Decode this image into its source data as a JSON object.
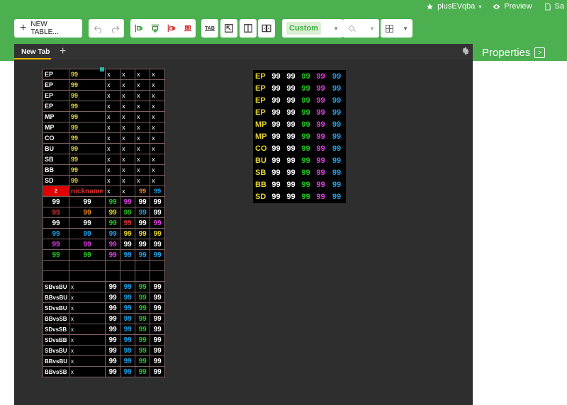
{
  "header": {
    "user": "plusEVqba",
    "preview": "Preview",
    "save_partial": "Sa"
  },
  "toolbar": {
    "new_table": "NEW TABLE...",
    "style_value": "Custom",
    "tab_icon_label": "TAB"
  },
  "editor": {
    "tab_label": "New Tab",
    "add_tab": "+"
  },
  "properties": {
    "title": "Properties",
    "toggle": ">"
  },
  "colors": {
    "green_header": "#4caf50",
    "yellow": "#e8d630",
    "white": "#ffffff",
    "green": "#21c721",
    "magenta": "#e040e0",
    "blue": "#1ea0e6",
    "orange": "#ef8a1e",
    "red": "#e03030"
  },
  "main_table": {
    "pos_rows": [
      {
        "pos": "EP",
        "val": "99",
        "cells": [
          "x",
          "x",
          "x",
          "x"
        ]
      },
      {
        "pos": "EP",
        "val": "99",
        "cells": [
          "x",
          "x",
          "x",
          "x"
        ]
      },
      {
        "pos": "EP",
        "val": "99",
        "cells": [
          "x",
          "x",
          "x",
          "x"
        ]
      },
      {
        "pos": "EP",
        "val": "99",
        "cells": [
          "x",
          "x",
          "x",
          "x"
        ]
      },
      {
        "pos": "MP",
        "val": "99",
        "cells": [
          "x",
          "x",
          "x",
          "x"
        ]
      },
      {
        "pos": "MP",
        "val": "99",
        "cells": [
          "x",
          "x",
          "x",
          "x"
        ]
      },
      {
        "pos": "CO",
        "val": "99",
        "cells": [
          "x",
          "x",
          "x",
          "x"
        ]
      },
      {
        "pos": "BU",
        "val": "99",
        "cells": [
          "x",
          "x",
          "x",
          "x"
        ]
      },
      {
        "pos": "SB",
        "val": "99",
        "cells": [
          "x",
          "x",
          "x",
          "x"
        ]
      },
      {
        "pos": "BB",
        "val": "99",
        "cells": [
          "x",
          "x",
          "x",
          "x"
        ]
      },
      {
        "pos": "SD",
        "val": "99",
        "cells": [
          "x",
          "x",
          "x",
          "x"
        ]
      }
    ],
    "nick_row": {
      "badge": "2",
      "nickname": "nickname",
      "c1": "x",
      "c2": "x",
      "c3": "99",
      "c4": "99"
    },
    "stat_rows": [
      [
        "99",
        "99",
        "99",
        "99",
        "99",
        "99"
      ],
      [
        "99",
        "99",
        "99",
        "99",
        "99",
        "99"
      ],
      [
        "99",
        "99",
        "99",
        "99",
        "99",
        "99"
      ],
      [
        "99",
        "99",
        "99",
        "99",
        "99",
        "99"
      ],
      [
        "99",
        "99",
        "99",
        "99",
        "99",
        "99"
      ],
      [
        "99",
        "99",
        "99",
        "99",
        "99",
        "99"
      ]
    ],
    "matchup_rows": [
      {
        "label": "SBvsBU",
        "x": "x",
        "v": [
          "99",
          "99",
          "99",
          "99"
        ]
      },
      {
        "label": "BBvsBU",
        "x": "x",
        "v": [
          "99",
          "99",
          "99",
          "99"
        ]
      },
      {
        "label": "SDvsBU",
        "x": "x",
        "v": [
          "99",
          "99",
          "99",
          "99"
        ]
      },
      {
        "label": "BBvsSB",
        "x": "x",
        "v": [
          "99",
          "99",
          "99",
          "99"
        ]
      },
      {
        "label": "SDvsSB",
        "x": "x",
        "v": [
          "99",
          "99",
          "99",
          "99"
        ]
      },
      {
        "label": "SDvsBB",
        "x": "x",
        "v": [
          "99",
          "99",
          "99",
          "99"
        ]
      },
      {
        "label": "SBvsBU",
        "x": "x",
        "v": [
          "99",
          "99",
          "99",
          "99"
        ]
      },
      {
        "label": "BBvsBU",
        "x": "x",
        "v": [
          "99",
          "99",
          "99",
          "99"
        ]
      },
      {
        "label": "BBvsSB",
        "x": "x",
        "v": [
          "99",
          "99",
          "99",
          "99"
        ]
      }
    ]
  },
  "side_table": {
    "rows": [
      {
        "pos": "EP",
        "v": [
          "99",
          "99",
          "99",
          "99",
          "99"
        ]
      },
      {
        "pos": "EP",
        "v": [
          "99",
          "99",
          "99",
          "99",
          "99"
        ]
      },
      {
        "pos": "EP",
        "v": [
          "99",
          "99",
          "99",
          "99",
          "99"
        ]
      },
      {
        "pos": "EP",
        "v": [
          "99",
          "99",
          "99",
          "99",
          "99"
        ]
      },
      {
        "pos": "MP",
        "v": [
          "99",
          "99",
          "99",
          "99",
          "99"
        ]
      },
      {
        "pos": "MP",
        "v": [
          "99",
          "99",
          "99",
          "99",
          "99"
        ]
      },
      {
        "pos": "CO",
        "v": [
          "99",
          "99",
          "99",
          "99",
          "99"
        ]
      },
      {
        "pos": "BU",
        "v": [
          "99",
          "99",
          "99",
          "99",
          "99"
        ]
      },
      {
        "pos": "SB",
        "v": [
          "99",
          "99",
          "99",
          "99",
          "99"
        ]
      },
      {
        "pos": "BB",
        "v": [
          "99",
          "99",
          "99",
          "99",
          "99"
        ]
      },
      {
        "pos": "SD",
        "v": [
          "99",
          "99",
          "99",
          "99",
          "99"
        ]
      }
    ]
  }
}
